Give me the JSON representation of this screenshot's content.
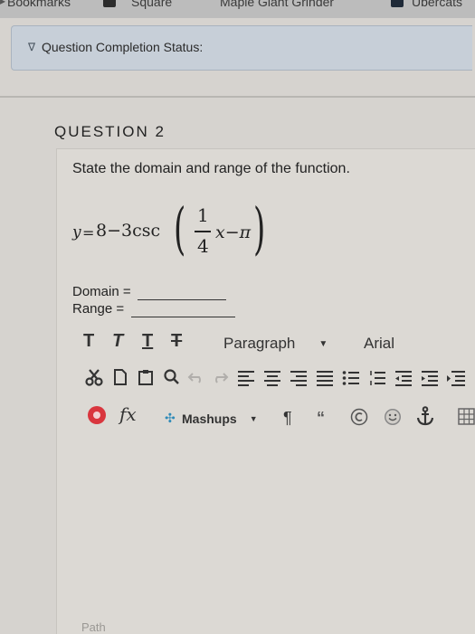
{
  "bookmarks": {
    "items": [
      "Bookmarks",
      "Square",
      "Maple Giant Grinder",
      "Ubercats"
    ]
  },
  "status": {
    "label": "Question Completion Status:"
  },
  "question": {
    "title": "QUESTION 2",
    "prompt": "State the domain and range of the function.",
    "equation": {
      "lhs": "y",
      "equals": "=",
      "main": "8−3csc",
      "numerator": "1",
      "denominator": "4",
      "tail": "x−π"
    },
    "domain_label": "Domain =",
    "range_label": "Range ="
  },
  "editor": {
    "paragraph_label": "Paragraph",
    "font_label": "Arial",
    "mashups_label": "Mashups",
    "fx_label": "fx",
    "path_label": "Path"
  },
  "colors": {
    "accent_red": "#d9363e",
    "status_bar_bg": "#c7cfd8"
  }
}
